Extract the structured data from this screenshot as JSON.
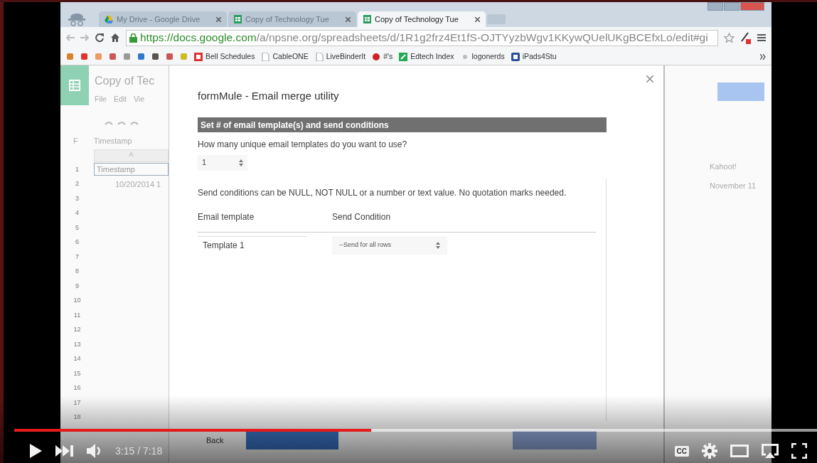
{
  "browser": {
    "tabs": [
      {
        "label": "My Drive - Google Drive",
        "selected": false
      },
      {
        "label": "Copy of Technology Tue",
        "selected": false
      },
      {
        "label": "Copy of Technology Tue",
        "selected": true
      }
    ],
    "url": {
      "host": "https://docs.google.com",
      "path": "/a/npsne.org/spreadsheets/d/1R1g2frz4Et1fS-OJTYyzbWgv1KKywQUelUKgBCEfxLo/edit#gi"
    },
    "bookmarks": [
      {
        "label": "Bell Schedules"
      },
      {
        "label": "CableONE"
      },
      {
        "label": "LiveBinderIt"
      },
      {
        "label": "#'s"
      },
      {
        "label": "Edtech Index"
      },
      {
        "label": "logonerds"
      },
      {
        "label": "iPads4Stu"
      }
    ]
  },
  "sheet": {
    "title": "Copy of Tec",
    "menus": [
      "File",
      "Edit",
      "Vie"
    ],
    "formula_bar": "Timestamp",
    "name_box": "F",
    "column_header": "A",
    "rows": [
      {
        "number": "1",
        "value": "Timestamp"
      },
      {
        "number": "2",
        "value": "10/20/2014 1"
      },
      {
        "number": "3",
        "value": ""
      },
      {
        "number": "4",
        "value": ""
      },
      {
        "number": "5",
        "value": ""
      },
      {
        "number": "6",
        "value": ""
      },
      {
        "number": "7",
        "value": ""
      },
      {
        "number": "8",
        "value": ""
      },
      {
        "number": "9",
        "value": ""
      },
      {
        "number": "10",
        "value": ""
      },
      {
        "number": "11",
        "value": ""
      },
      {
        "number": "12",
        "value": ""
      },
      {
        "number": "13",
        "value": ""
      },
      {
        "number": "14",
        "value": ""
      },
      {
        "number": "15",
        "value": ""
      },
      {
        "number": "16",
        "value": ""
      },
      {
        "number": "17",
        "value": ""
      },
      {
        "number": "18",
        "value": ""
      }
    ],
    "right_cells": [
      "Kahoot!",
      "November 11"
    ]
  },
  "dialog": {
    "title": "formMule - Email merge utility",
    "section": "Set # of email template(s) and send conditions",
    "question": "How many unique email templates do you want to use?",
    "template_count": "1",
    "note": "Send conditions can be NULL, NOT NULL or a number or text value. No quotation marks needed.",
    "columns": [
      "Email template",
      "Send Condition"
    ],
    "rows": [
      {
        "template": "Template 1",
        "condition": "--Send for all rows"
      }
    ],
    "back": "Back"
  },
  "player": {
    "progress": {
      "level": 0.445
    },
    "time": "3:15 / 7:18",
    "cc": "CC"
  }
}
